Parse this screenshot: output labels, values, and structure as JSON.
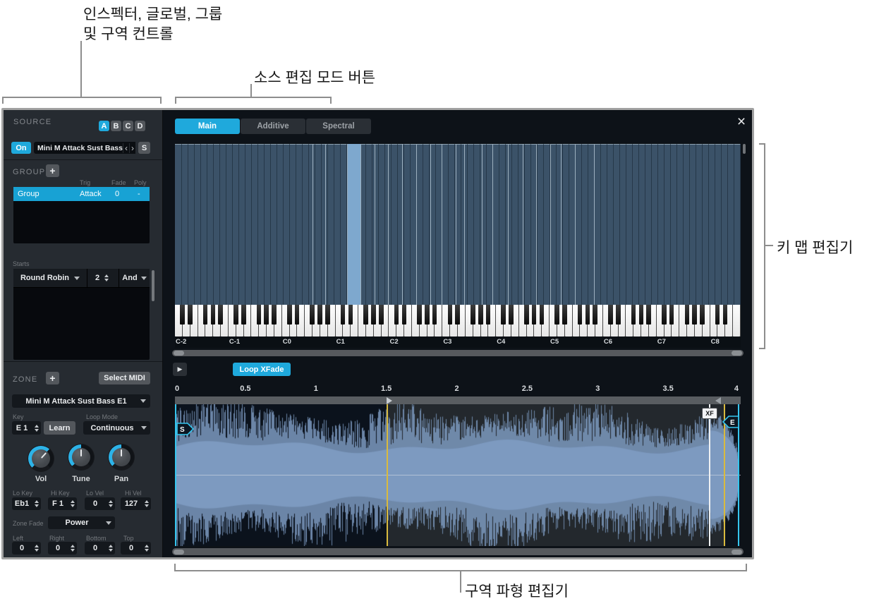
{
  "callouts": {
    "inspector_line1": "인스펙터, 글로벌, 그룹",
    "inspector_line2": "및 구역 컨트롤",
    "source_modes": "소스 편집 모드 버튼",
    "key_map": "키 맵 편집기",
    "zone_waveform": "구역 파형 편집기"
  },
  "source": {
    "label": "SOURCE",
    "layers": [
      "A",
      "B",
      "C",
      "D"
    ],
    "active_layer": "A",
    "on_label": "On",
    "name": "Mini M Attack Sust Bass",
    "prev": "‹",
    "next": "›",
    "solo": "S"
  },
  "group": {
    "label": "GROUP",
    "add": "+",
    "headers": {
      "trig": "Trig",
      "fade": "Fade",
      "poly": "Poly"
    },
    "row": {
      "name": "Group",
      "trig": "Attack",
      "fade": "0",
      "poly": "-"
    },
    "starts_label": "Starts",
    "starts": {
      "mode": "Round Robin",
      "count": "2",
      "op": "And"
    }
  },
  "zone": {
    "label": "ZONE",
    "add": "+",
    "select_midi": "Select MIDI",
    "name": "Mini M Attack Sust Bass E1",
    "key_label": "Key",
    "key": "E 1",
    "learn": "Learn",
    "loop_mode_label": "Loop Mode",
    "loop_mode": "Continuous",
    "knobs": [
      {
        "label": "Vol"
      },
      {
        "label": "Tune"
      },
      {
        "label": "Pan"
      }
    ],
    "range": {
      "lo_key_label": "Lo Key",
      "lo_key": "Eb1",
      "hi_key_label": "Hi Key",
      "hi_key": "F 1",
      "lo_vel_label": "Lo Vel",
      "lo_vel": "0",
      "hi_vel_label": "Hi Vel",
      "hi_vel": "127"
    },
    "zone_fade_label": "Zone Fade",
    "zone_fade": "Power",
    "fade": {
      "left_label": "Left",
      "left": "0",
      "right_label": "Right",
      "right": "0",
      "bottom_label": "Bottom",
      "bottom": "0",
      "top_label": "Top",
      "top": "0"
    }
  },
  "editor": {
    "tabs": [
      "Main",
      "Additive",
      "Spectral"
    ],
    "active_tab": "Main",
    "close": "×",
    "octaves": [
      "C-2",
      "C-1",
      "C0",
      "C1",
      "C2",
      "C3",
      "C4",
      "C5",
      "C6",
      "C7",
      "C8"
    ],
    "play": "▶",
    "loop_xfade": "Loop XFade",
    "ruler": [
      "0",
      "0.5",
      "1",
      "1.5",
      "2",
      "2.5",
      "3",
      "3.5",
      "4"
    ],
    "markers": {
      "start": "S",
      "end": "E",
      "xfade": "XF"
    }
  },
  "colors": {
    "accent": "#1fa9dc",
    "selection": "#18a2d4",
    "keymap_zone": "#3b5268",
    "keymap_zone_selected": "#7ea8ce",
    "waveform": "#7d9ac0",
    "loop_line": "#d9ba3e",
    "marker_line": "#35c5ee"
  }
}
